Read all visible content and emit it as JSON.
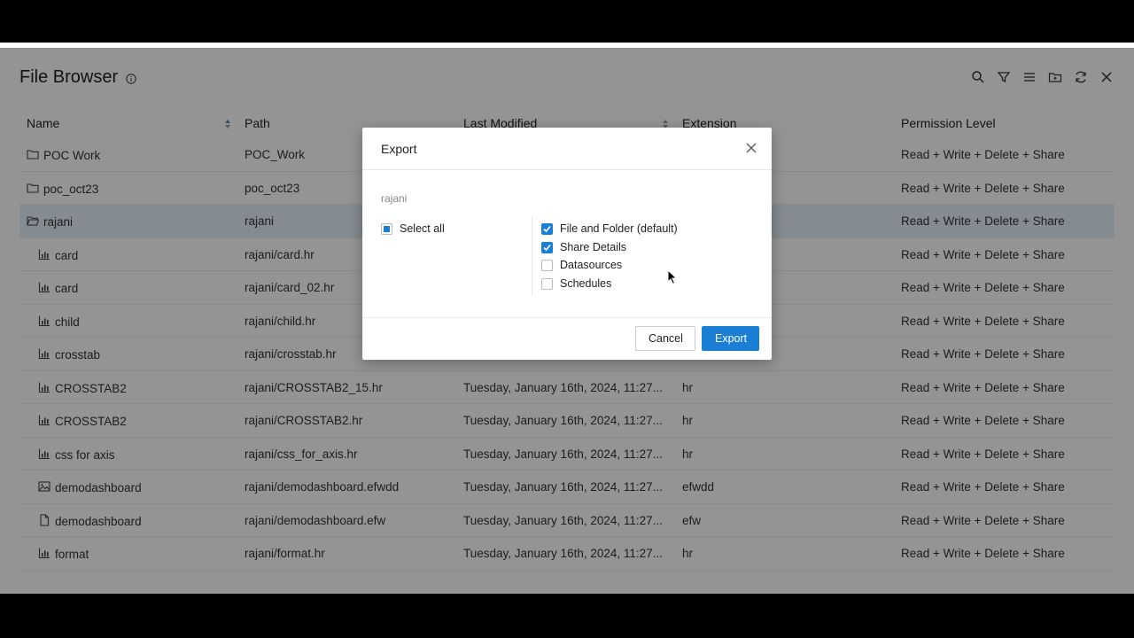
{
  "app": {
    "title": "File Browser",
    "toolbar": [
      "search-icon",
      "filter-icon",
      "list-icon",
      "folder-icon",
      "refresh-icon",
      "close-icon"
    ]
  },
  "table": {
    "columns": [
      "Name",
      "Path",
      "Last Modified",
      "Extension",
      "Permission Level"
    ],
    "rows": [
      {
        "name": "POC Work",
        "path": "POC_Work",
        "modified": "",
        "ext": "",
        "perm": "Read + Write + Delete + Share",
        "icon": "folder"
      },
      {
        "name": "poc_oct23",
        "path": "poc_oct23",
        "modified": "",
        "ext": "",
        "perm": "Read + Write + Delete + Share",
        "icon": "folder"
      },
      {
        "name": "rajani",
        "path": "rajani",
        "modified": "",
        "ext": "",
        "perm": "Read + Write + Delete + Share",
        "icon": "folder-open"
      },
      {
        "name": "card",
        "path": "rajani/card.hr",
        "modified": "",
        "ext": "",
        "perm": "Read + Write + Delete + Share",
        "icon": "chart"
      },
      {
        "name": "card",
        "path": "rajani/card_02.hr",
        "modified": "",
        "ext": "",
        "perm": "Read + Write + Delete + Share",
        "icon": "chart"
      },
      {
        "name": "child",
        "path": "rajani/child.hr",
        "modified": "",
        "ext": "",
        "perm": "Read + Write + Delete + Share",
        "icon": "chart"
      },
      {
        "name": "crosstab",
        "path": "rajani/crosstab.hr",
        "modified": "",
        "ext": "",
        "perm": "Read + Write + Delete + Share",
        "icon": "chart"
      },
      {
        "name": "CROSSTAB2",
        "path": "rajani/CROSSTAB2_15.hr",
        "modified": "Tuesday, January 16th, 2024, 11:27...",
        "ext": "hr",
        "perm": "Read + Write + Delete + Share",
        "icon": "chart"
      },
      {
        "name": "CROSSTAB2",
        "path": "rajani/CROSSTAB2.hr",
        "modified": "Tuesday, January 16th, 2024, 11:27...",
        "ext": "hr",
        "perm": "Read + Write + Delete + Share",
        "icon": "chart"
      },
      {
        "name": "css for axis",
        "path": "rajani/css_for_axis.hr",
        "modified": "Tuesday, January 16th, 2024, 11:27...",
        "ext": "hr",
        "perm": "Read + Write + Delete + Share",
        "icon": "chart"
      },
      {
        "name": "demodashboard",
        "path": "rajani/demodashboard.efwdd",
        "modified": "Tuesday, January 16th, 2024, 11:27...",
        "ext": "efwdd",
        "perm": "Read + Write + Delete + Share",
        "icon": "image"
      },
      {
        "name": "demodashboard",
        "path": "rajani/demodashboard.efw",
        "modified": "Tuesday, January 16th, 2024, 11:27...",
        "ext": "efw",
        "perm": "Read + Write + Delete + Share",
        "icon": "file"
      },
      {
        "name": "format",
        "path": "rajani/format.hr",
        "modified": "Tuesday, January 16th, 2024, 11:27...",
        "ext": "hr",
        "perm": "Read + Write + Delete + Share",
        "icon": "chart"
      }
    ]
  },
  "modal": {
    "title": "Export",
    "subtitle": "rajani",
    "select_all": "Select all",
    "options": [
      {
        "label": "File and Folder (default)",
        "checked": true
      },
      {
        "label": "Share Details",
        "checked": true
      },
      {
        "label": "Datasources",
        "checked": false
      },
      {
        "label": "Schedules",
        "checked": false
      }
    ],
    "cancel": "Cancel",
    "export": "Export"
  },
  "colors": {
    "accent": "#1a7fd4",
    "selected_row": "#e3f0fa",
    "overlay": "rgba(0,0,0,0.42)"
  }
}
